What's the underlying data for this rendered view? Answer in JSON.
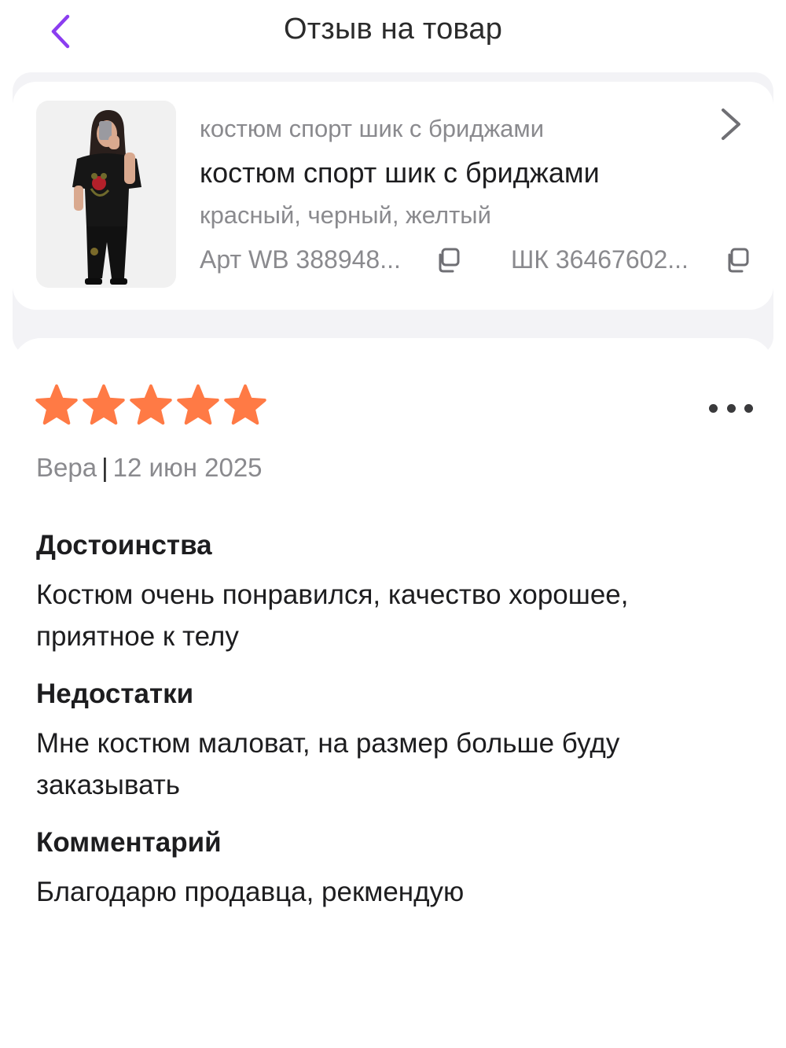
{
  "header": {
    "title": "Отзыв на товар"
  },
  "colors": {
    "accent": "#8b3df0",
    "star": "#ff7a45",
    "muted_text": "#8a8a8e",
    "band": "#f3f3f6"
  },
  "product": {
    "subtitle": "костюм спорт шик с бриджами",
    "name": "костюм спорт шик с бриджами",
    "colors": "красный, черный, желтый",
    "article": "Арт WB 388948...",
    "barcode": "ШК 36467602...",
    "image_icon": "product-photo"
  },
  "review": {
    "rating": 5,
    "rating_max": 5,
    "author": "Вера",
    "separator": "|",
    "date": "12 июн 2025",
    "sections": [
      {
        "title": "Достоинства",
        "text": "Костюм очень понравился, качество хорошее, приятное к телу"
      },
      {
        "title": "Недостатки",
        "text": "Мне костюм маловат, на размер больше буду заказывать"
      },
      {
        "title": "Комментарий",
        "text": "Благодарю продавца, рекмендую"
      }
    ]
  }
}
